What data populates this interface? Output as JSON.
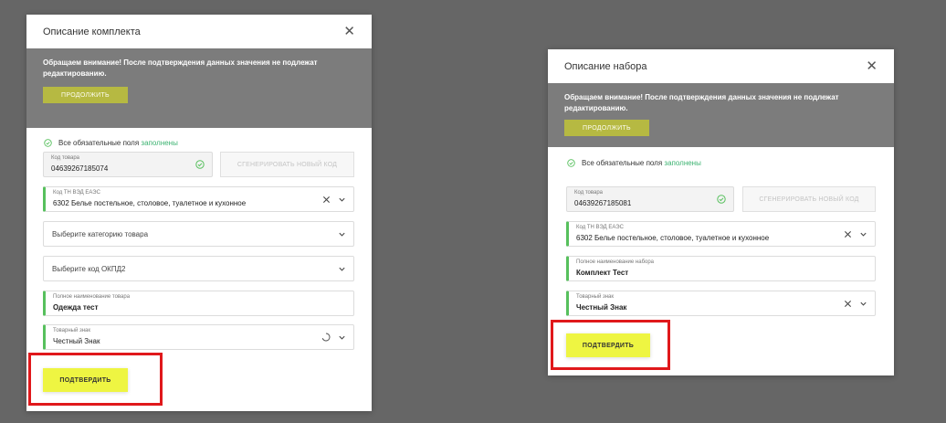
{
  "colors": {
    "backdrop": "#666666",
    "notice_bg": "#7c7c7c",
    "continue_btn": "#b6b942",
    "confirm_btn": "#eef542",
    "valid_accent": "#57c05d",
    "highlight": "#e0181b"
  },
  "left_modal": {
    "title": "Описание комплекта",
    "close_icon": "close-icon",
    "notice": {
      "text": "Обращаем внимание! После подтверждения данных значения не подлежат редактированию.",
      "continue_label": "ПРОДОЛЖИТЬ"
    },
    "status": {
      "prefix": "Все обязательные поля",
      "highlight": "заполнены"
    },
    "code_field": {
      "label": "Код товара",
      "value": "04639267185074"
    },
    "generate_label": "СГЕНЕРИРОВАТЬ НОВЫЙ КОД",
    "tnved_field": {
      "label": "Код ТН ВЭД ЕАЭС",
      "value": "6302 Белье постельное, столовое, туалетное и кухонное"
    },
    "category_placeholder": "Выберите категорию товара",
    "okpd_placeholder": "Выберите код ОКПД2",
    "fullname_field": {
      "label": "Полное наименование товара",
      "value": "Одежда тест"
    },
    "trademark_field": {
      "label": "Товарный знак",
      "value": "Честный Знак"
    },
    "confirm_label": "ПОДТВЕРДИТЬ"
  },
  "right_modal": {
    "title": "Описание набора",
    "close_icon": "close-icon",
    "notice": {
      "text": "Обращаем внимание! После подтверждения данных значения не подлежат редактированию.",
      "continue_label": "ПРОДОЛЖИТЬ"
    },
    "status": {
      "prefix": "Все обязательные поля",
      "highlight": "заполнены"
    },
    "code_field": {
      "label": "Код товара",
      "value": "04639267185081"
    },
    "generate_label": "СГЕНЕРИРОВАТЬ НОВЫЙ КОД",
    "tnved_field": {
      "label": "Код ТН ВЭД ЕАЭС",
      "value": "6302 Белье постельное, столовое, туалетное и кухонное"
    },
    "fullname_field": {
      "label": "Полное наименование набора",
      "value": "Комплект Тест"
    },
    "trademark_field": {
      "label": "Товарный знак",
      "value": "Честный Знак"
    },
    "confirm_label": "ПОДТВЕРДИТЬ"
  }
}
